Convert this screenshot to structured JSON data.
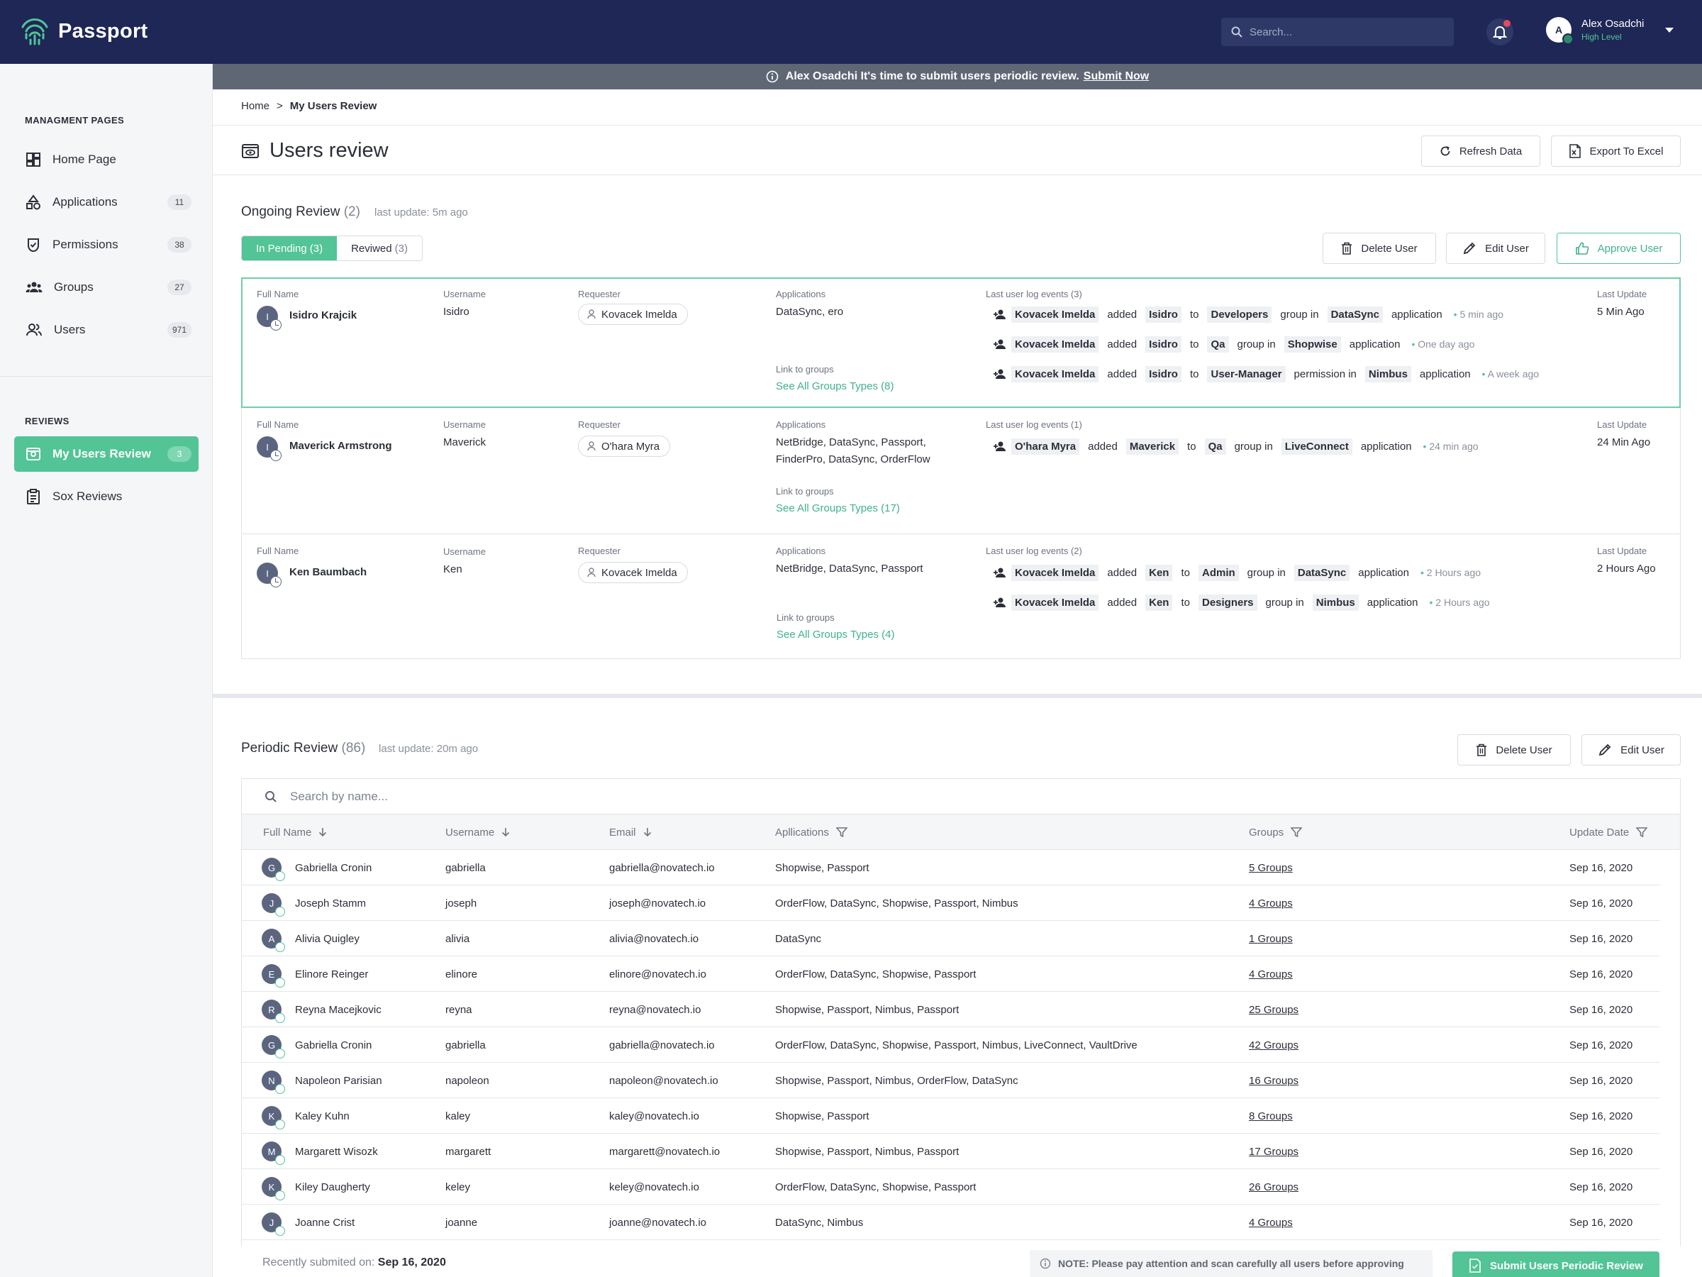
{
  "app": {
    "name": "Passport"
  },
  "search": {
    "placeholder": "Search..."
  },
  "user": {
    "initial": "A",
    "name": "Alex Osadchi",
    "level": "High Level"
  },
  "banner": {
    "message": "Alex Osadchi It's time to submit users periodic review.",
    "link": "Submit Now"
  },
  "sidebar": {
    "management_heading": "MANAGMENT PAGES",
    "reviews_heading": "REVIEWS",
    "items": [
      {
        "label": "Home Page",
        "icon": "dashboard-icon",
        "count": ""
      },
      {
        "label": "Applications",
        "icon": "shapes-icon",
        "count": "11"
      },
      {
        "label": "Permissions",
        "icon": "shield-check-icon",
        "count": "38"
      },
      {
        "label": "Groups",
        "icon": "groups-icon",
        "count": "27"
      },
      {
        "label": "Users",
        "icon": "users-icon",
        "count": "971"
      }
    ],
    "reviews": [
      {
        "label": "My Users Review",
        "icon": "review-icon",
        "count": "3",
        "active": true
      },
      {
        "label": "Sox Reviews",
        "icon": "clipboard-icon",
        "count": ""
      }
    ]
  },
  "breadcrumb": {
    "home": "Home",
    "separator": ">",
    "current": "My Users Review"
  },
  "page": {
    "title": "Users review",
    "refresh": "Refresh Data",
    "export": "Export To Excel"
  },
  "ongoing": {
    "title": "Ongoing Review",
    "count": "(2)",
    "updated": "last update: 5m ago",
    "tabs": [
      {
        "label": "In Pending",
        "count": "(3)"
      },
      {
        "label": "Reviwed",
        "count": "(3)"
      }
    ],
    "actions": {
      "delete": "Delete User",
      "edit": "Edit User",
      "approve": "Approve User"
    },
    "labels": {
      "full_name": "Full Name",
      "username": "Username",
      "requester": "Requester",
      "applications": "Applications",
      "link_groups": "Link to groups",
      "last_update": "Last Update"
    },
    "cards": [
      {
        "initial": "I",
        "name": "Isidro Krajcik",
        "username": "Isidro",
        "requester": "Kovacek Imelda",
        "applications": [
          "DataSync, ero"
        ],
        "groups_link": "See All Groups Types (8)",
        "events_title": "Last user log events (3)",
        "events": [
          {
            "actor": "Kovacek Imelda",
            "verb": "added",
            "user": "Isidro",
            "to": "to",
            "target": "Developers",
            "kind": "group in",
            "app": "DataSync",
            "tail": "application",
            "time": "5 min ago"
          },
          {
            "actor": "Kovacek Imelda",
            "verb": "added",
            "user": "Isidro",
            "to": "to",
            "target": "Qa",
            "kind": "group in",
            "app": "Shopwise",
            "tail": "application",
            "time": "One day ago"
          },
          {
            "actor": "Kovacek Imelda",
            "verb": "added",
            "user": "Isidro",
            "to": "to",
            "target": "User-Manager",
            "kind": "permission in",
            "app": "Nimbus",
            "tail": "application",
            "time": "A week ago"
          }
        ],
        "last_update": "5 Min Ago"
      },
      {
        "initial": "I",
        "name": "Maverick Armstrong",
        "username": "Maverick",
        "requester": "O'hara Myra",
        "applications": [
          "NetBridge, DataSync, Passport,",
          "FinderPro, DataSync, OrderFlow"
        ],
        "groups_link": "See All Groups Types (17)",
        "events_title": "Last user log events (1)",
        "events": [
          {
            "actor": "O'hara Myra",
            "verb": "added",
            "user": "Maverick",
            "to": "to",
            "target": "Qa",
            "kind": "group in",
            "app": "LiveConnect",
            "tail": "application",
            "time": "24 min ago"
          }
        ],
        "last_update": "24 Min Ago"
      },
      {
        "initial": "I",
        "name": "Ken Baumbach",
        "username": "Ken",
        "requester": "Kovacek Imelda",
        "applications": [
          "NetBridge, DataSync, Passport"
        ],
        "groups_link": "See All Groups Types (4)",
        "events_title": "Last user log events (2)",
        "events": [
          {
            "actor": "Kovacek Imelda",
            "verb": "added",
            "user": "Ken",
            "to": "to",
            "target": "Admin",
            "kind": "group in",
            "app": "DataSync",
            "tail": "application",
            "time": "2 Hours ago"
          },
          {
            "actor": "Kovacek Imelda",
            "verb": "added",
            "user": "Ken",
            "to": "to",
            "target": "Designers",
            "kind": "group in",
            "app": "Nimbus",
            "tail": "application",
            "time": "2 Hours ago"
          }
        ],
        "last_update": "2 Hours Ago"
      }
    ]
  },
  "periodic": {
    "title": "Periodic Review",
    "count": "(86)",
    "updated": "last update: 20m ago",
    "actions": {
      "delete": "Delete User",
      "edit": "Edit User"
    },
    "search_placeholder": "Search by name...",
    "columns": {
      "full_name": "Full Name",
      "username": "Username",
      "email": "Email",
      "applications": "Apllications",
      "groups": "Groups",
      "date": "Update Date"
    },
    "rows": [
      {
        "initial": "G",
        "name": "Gabriella Cronin",
        "username": "gabriella",
        "email": "gabriella@novatech.io",
        "apps": "Shopwise, Passport",
        "groups": "5 Groups",
        "date": "Sep 16, 2020"
      },
      {
        "initial": "J",
        "name": "Joseph Stamm",
        "username": "joseph",
        "email": "joseph@novatech.io",
        "apps": "OrderFlow, DataSync, Shopwise, Passport, Nimbus",
        "groups": "4 Groups",
        "date": "Sep 16, 2020"
      },
      {
        "initial": "A",
        "name": "Alivia Quigley",
        "username": "alivia",
        "email": "alivia@novatech.io",
        "apps": "DataSync",
        "groups": "1 Groups",
        "date": "Sep 16, 2020"
      },
      {
        "initial": "E",
        "name": "Elinore Reinger",
        "username": "elinore",
        "email": "elinore@novatech.io",
        "apps": "OrderFlow, DataSync, Shopwise, Passport",
        "groups": "4 Groups",
        "date": "Sep 16, 2020"
      },
      {
        "initial": "R",
        "name": "Reyna Macejkovic",
        "username": "reyna",
        "email": "reyna@novatech.io",
        "apps": "Shopwise, Passport, Nimbus, Passport",
        "groups": "25 Groups",
        "date": "Sep 16, 2020"
      },
      {
        "initial": "G",
        "name": "Gabriella Cronin",
        "username": "gabriella",
        "email": "gabriella@novatech.io",
        "apps": "OrderFlow, DataSync, Shopwise, Passport, Nimbus, LiveConnect, VaultDrive",
        "groups": "42 Groups",
        "date": "Sep 16, 2020"
      },
      {
        "initial": "N",
        "name": "Napoleon Parisian",
        "username": "napoleon",
        "email": "napoleon@novatech.io",
        "apps": "Shopwise, Passport, Nimbus, OrderFlow, DataSync",
        "groups": "16 Groups",
        "date": "Sep 16, 2020"
      },
      {
        "initial": "K",
        "name": "Kaley Kuhn",
        "username": "kaley",
        "email": "kaley@novatech.io",
        "apps": "Shopwise, Passport",
        "groups": "8 Groups",
        "date": "Sep 16, 2020"
      },
      {
        "initial": "M",
        "name": "Margarett Wisozk",
        "username": "margarett",
        "email": "margarett@novatech.io",
        "apps": "Shopwise, Passport, Nimbus, Passport",
        "groups": "17 Groups",
        "date": "Sep 16, 2020"
      },
      {
        "initial": "K",
        "name": "Kiley Daugherty",
        "username": "keley",
        "email": "keley@novatech.io",
        "apps": "OrderFlow, DataSync, Shopwise, Passport",
        "groups": "26 Groups",
        "date": "Sep 16, 2020"
      },
      {
        "initial": "J",
        "name": "Joanne Crist",
        "username": "joanne",
        "email": "joanne@novatech.io",
        "apps": "DataSync, Nimbus",
        "groups": "4 Groups",
        "date": "Sep 16, 2020"
      }
    ],
    "recent_label": "Recently submited on:",
    "recent_date": "Sep 16, 2020",
    "note": "NOTE: Please pay attention and scan carefully all users before approving",
    "submit": "Submit Users Periodic Review"
  },
  "colors": {
    "navy": "#1e2756",
    "accent": "#52c496",
    "banner": "#5f6775"
  }
}
